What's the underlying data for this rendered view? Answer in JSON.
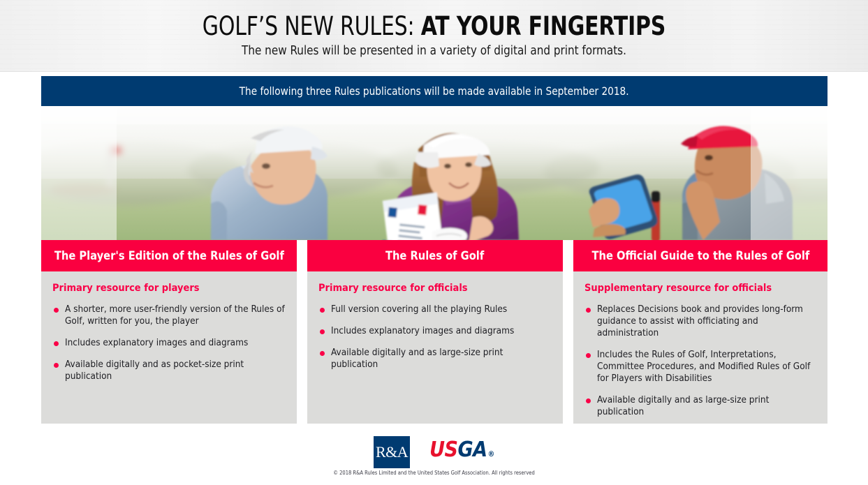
{
  "header": {
    "title_light": "GOLF’S NEW RULES: ",
    "title_bold": "AT YOUR FINGERTIPS",
    "subtitle": "The new Rules will be presented in a variety of digital and print formats."
  },
  "banner": {
    "text": "The following three Rules publications will be made available in September 2018."
  },
  "photo": {
    "alt": "Three golfers on a course: an older man in a light blue polo and white cap, a woman in a purple polo and white visor holding a Rules booklet, and a man in a red cap and blue-grey polo holding a smartphone."
  },
  "columns": [
    {
      "heading": "The Player's Edition of the Rules of Golf",
      "subheading": "Primary resource for players",
      "bullets": [
        "A shorter, more user-friendly version of the Rules of Golf, written for you, the player",
        "Includes explanatory images and diagrams",
        "Available digitally and as pocket-size print publication"
      ]
    },
    {
      "heading": "The Rules of Golf",
      "subheading": "Primary resource for officials",
      "bullets": [
        "Full version covering all the playing Rules",
        "Includes explanatory images and diagrams",
        "Available digitally and as large-size print publication"
      ]
    },
    {
      "heading": "The Official Guide to the Rules of Golf",
      "subheading": "Supplementary resource for officials",
      "bullets": [
        "Replaces Decisions book and provides long-form guidance to assist with officiating and administration",
        "Includes the Rules of Golf, Interpretations, Committee Procedures, and Modified Rules of Golf for Players with Disabilities",
        "Available digitally and as large-size print publication"
      ]
    }
  ],
  "footer": {
    "ra_logo_text": "R&A",
    "usga_logo_us": "US",
    "usga_logo_ga": "GA",
    "usga_logo_dot": "®",
    "copyright": "© 2018 R&A Rules Limited and the United States Golf Association. All rights reserved"
  },
  "colors": {
    "navy": "#003b71",
    "red": "#fa0040",
    "red_text": "#fa0047",
    "panel_grey": "#dcdcda",
    "body_text": "#1d1d22",
    "usga_red": "#e8112d"
  }
}
